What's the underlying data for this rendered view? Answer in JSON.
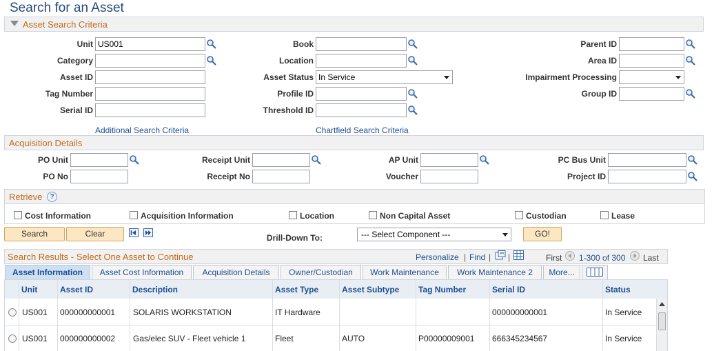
{
  "page": {
    "title": "Search for an Asset"
  },
  "criteria": {
    "header": "Asset Search Criteria",
    "unit": {
      "label": "Unit",
      "value": "US001"
    },
    "category": {
      "label": "Category",
      "value": ""
    },
    "asset_id": {
      "label": "Asset ID",
      "value": ""
    },
    "tag_number": {
      "label": "Tag Number",
      "value": ""
    },
    "serial_id": {
      "label": "Serial ID",
      "value": ""
    },
    "book": {
      "label": "Book",
      "value": ""
    },
    "location": {
      "label": "Location",
      "value": ""
    },
    "asset_status": {
      "label": "Asset Status",
      "value": "In Service"
    },
    "profile_id": {
      "label": "Profile ID",
      "value": ""
    },
    "threshold_id": {
      "label": "Threshold ID",
      "value": ""
    },
    "parent_id": {
      "label": "Parent ID",
      "value": ""
    },
    "area_id": {
      "label": "Area ID",
      "value": ""
    },
    "impairment": {
      "label": "Impairment Processing",
      "value": ""
    },
    "group_id": {
      "label": "Group ID",
      "value": ""
    },
    "additional_link": "Additional Search Criteria",
    "chartfield_link": "Chartfield Search Criteria"
  },
  "acquisition": {
    "header": "Acquisition Details",
    "po_unit": {
      "label": "PO Unit",
      "value": ""
    },
    "po_no": {
      "label": "PO No",
      "value": ""
    },
    "receipt_unit": {
      "label": "Receipt Unit",
      "value": ""
    },
    "receipt_no": {
      "label": "Receipt No",
      "value": ""
    },
    "ap_unit": {
      "label": "AP Unit",
      "value": ""
    },
    "voucher": {
      "label": "Voucher",
      "value": ""
    },
    "pc_bus_unit": {
      "label": "PC Bus Unit",
      "value": ""
    },
    "project_id": {
      "label": "Project ID",
      "value": ""
    }
  },
  "retrieve": {
    "header": "Retrieve",
    "help_icon": "?",
    "options": [
      "Cost Information",
      "Acquisition Information",
      "Location",
      "Non Capital Asset",
      "Custodian",
      "Lease"
    ]
  },
  "actions": {
    "search": "Search",
    "clear": "Clear",
    "drill_label": "Drill-Down To:",
    "drill_value": "--- Select Component ---",
    "go": "GO!"
  },
  "results": {
    "header": "Search Results - Select One Asset to Continue",
    "personalize": "Personalize",
    "find": "Find",
    "separator": "|",
    "first": "First",
    "range": "1-300 of 300",
    "last": "Last",
    "tabs": [
      "Asset Information",
      "Asset Cost Information",
      "Acquisition Details",
      "Owner/Custodian",
      "Work Maintenance",
      "Work Maintenance 2",
      "More..."
    ],
    "columns": [
      "Unit",
      "Asset ID",
      "Description",
      "Asset Type",
      "Asset Subtype",
      "Tag Number",
      "Serial ID",
      "Status"
    ],
    "rows": [
      [
        "US001",
        "000000000001",
        "SOLARIS WORKSTATION",
        "IT Hardware",
        "",
        "",
        "000000000001",
        "In Service"
      ],
      [
        "US001",
        "000000000002",
        "Gas/elec SUV - Fleet vehicle 1",
        "Fleet",
        "AUTO",
        "P00000009001",
        "666345234567",
        "In Service"
      ]
    ]
  },
  "colors": {
    "title": "#254a7a",
    "section_text": "#c3691b",
    "link": "#1d4e8f",
    "button": "#fbe7c2",
    "active_tab": "#cfe0f2"
  }
}
